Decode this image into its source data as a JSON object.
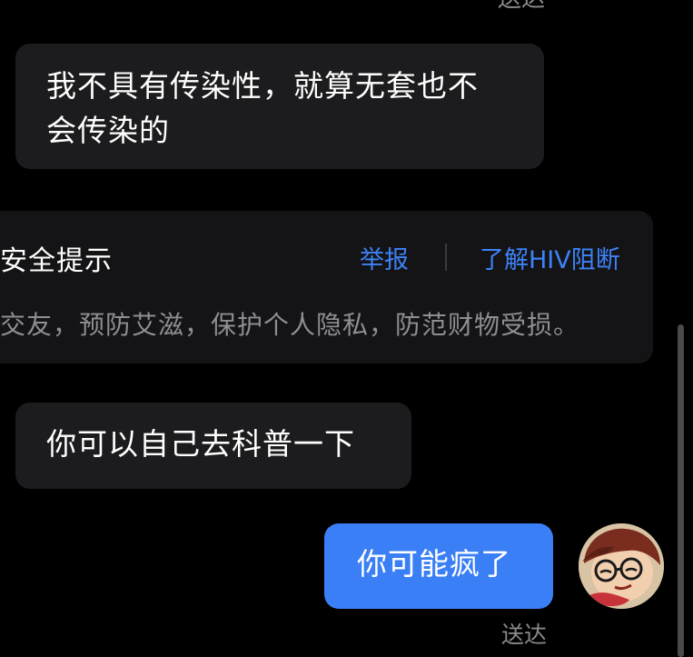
{
  "chat": {
    "top_status": "送达",
    "messages": [
      {
        "direction": "incoming",
        "text_line1": "我不具有传染性，就算无套也不",
        "text_line2": "会传染的"
      },
      {
        "direction": "incoming",
        "text": "你可以自己去科普一下"
      },
      {
        "direction": "outgoing",
        "text": "你可能疯了",
        "status": "送达"
      }
    ]
  },
  "safety_card": {
    "title": "安全提示",
    "report_label": "举报",
    "hiv_label": "了解HIV阻断",
    "body": "交友，预防艾滋，保护个人隐私，防范财物受损。"
  },
  "colors": {
    "background": "#000000",
    "incoming_bubble": "#1c1c1e",
    "outgoing_bubble": "#3b7ff6",
    "link": "#3d82f7",
    "muted_text": "#8e8e93"
  },
  "avatar": {
    "icon": "cartoon-avatar-icon"
  }
}
